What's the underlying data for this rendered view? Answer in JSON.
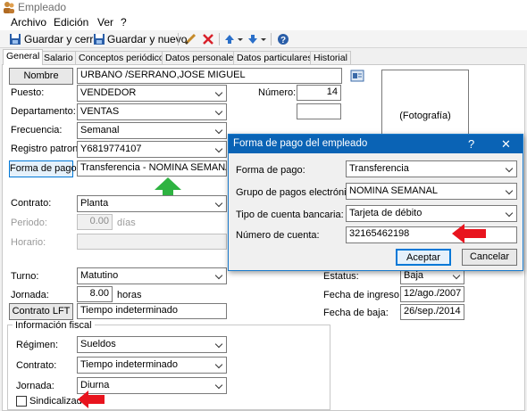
{
  "window": {
    "title": "Empleado"
  },
  "menu": {
    "items": [
      "Archivo",
      "Edición",
      "Ver",
      "?"
    ]
  },
  "toolbar": {
    "save_close": "Guardar y cerrar",
    "save_new": "Guardar y nuevo"
  },
  "tabs": [
    "General",
    "Salario",
    "Conceptos periódicos",
    "Datos personales",
    "Datos particulares",
    "Historial"
  ],
  "form": {
    "nombre_button": "Nombre",
    "nombre_value": "URBANO /SERRANO,JOSE MIGUEL",
    "puesto_label": "Puesto:",
    "puesto_value": "VENDEDOR",
    "numero_label": "Número:",
    "numero_value": "14",
    "departamento_label": "Departamento:",
    "departamento_value": "VENTAS",
    "frecuencia_label": "Frecuencia:",
    "frecuencia_value": "Semanal",
    "registro_label": "Registro patronal:",
    "registro_value": "Y6819774107",
    "forma_pago_button": "Forma de pago",
    "forma_pago_value": "Transferencia - NOMINA SEMANAL",
    "contrato_label": "Contrato:",
    "contrato_value": "Planta",
    "periodo_label": "Periodo:",
    "periodo_value": "0.00",
    "periodo_unit": "días",
    "horario_label": "Horario:",
    "turno_label": "Turno:",
    "turno_value": "Matutino",
    "jornada_label": "Jornada:",
    "jornada_value": "8.00",
    "jornada_unit": "horas",
    "contrato_lft_button": "Contrato LFT",
    "contrato_lft_value": "Tiempo indeterminado",
    "estatus_label": "Estatus:",
    "estatus_value": "Baja",
    "fecha_ingreso_label": "Fecha de ingreso:",
    "fecha_ingreso_value": "12/ago./2007",
    "fecha_baja_label": "Fecha de baja:",
    "fecha_baja_value": "26/sep./2014",
    "photo_placeholder": "(Fotografía)"
  },
  "fiscal": {
    "group_title": "Información fiscal",
    "regimen_label": "Régimen:",
    "regimen_value": "Sueldos",
    "contrato_label": "Contrato:",
    "contrato_value": "Tiempo indeterminado",
    "jornada_label": "Jornada:",
    "jornada_value": "Diurna",
    "sindicalizado_label": "Sindicalizado",
    "sindicalizado_checked": false
  },
  "dialog": {
    "title": "Forma de pago del empleado",
    "help": "?",
    "close": "✕",
    "forma_pago_label": "Forma de pago:",
    "forma_pago_value": "Transferencia",
    "grupo_label": "Grupo de pagos electrónicos:",
    "grupo_value": "NOMINA SEMANAL",
    "tipo_cuenta_label": "Tipo de cuenta bancaria:",
    "tipo_cuenta_value": "Tarjeta de débito",
    "numero_cuenta_label": "Número de cuenta:",
    "numero_cuenta_value": "32165462198",
    "accept": "Aceptar",
    "cancel": "Cancelar"
  },
  "colors": {
    "accent": "#0a63b5",
    "annotation_red": "#e8141e",
    "annotation_green": "#2eb341"
  }
}
